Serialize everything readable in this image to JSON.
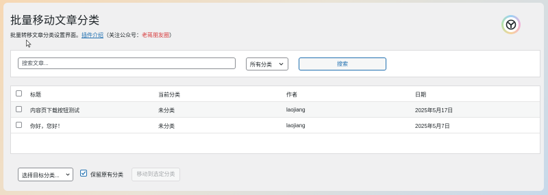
{
  "header": {
    "title": "批量移动文章分类",
    "subtitle_prefix": "批量转移文章分类设置界面。",
    "plugin_link": "插件介绍",
    "follow_prefix": "（关注公众号：",
    "account_name": "老蒋朋友圈",
    "follow_suffix": "）"
  },
  "search": {
    "placeholder": "搜索文章...",
    "category_selected": "所有分类",
    "button_label": "搜索"
  },
  "table": {
    "headers": [
      "标题",
      "当前分类",
      "作者",
      "日期"
    ],
    "rows": [
      {
        "title": "内容页下载按钮测试",
        "category": "未分类",
        "author": "laojiang",
        "date": "2025年5月17日"
      },
      {
        "title": "你好，您好！",
        "category": "未分类",
        "author": "laojiang",
        "date": "2025年5月7日"
      }
    ]
  },
  "bulk": {
    "target_selected": "选择目标分类...",
    "keep_label": "保留原有分类",
    "keep_checked": true,
    "move_button": "移动到选定分类"
  },
  "colors": {
    "link": "#2271b1",
    "accent_red": "#d63638",
    "panel_border": "#dcdcde"
  },
  "icons": [
    "plugin-logo-icon",
    "mouse-cursor-icon",
    "chevron-down-icon",
    "checkmark-icon"
  ]
}
